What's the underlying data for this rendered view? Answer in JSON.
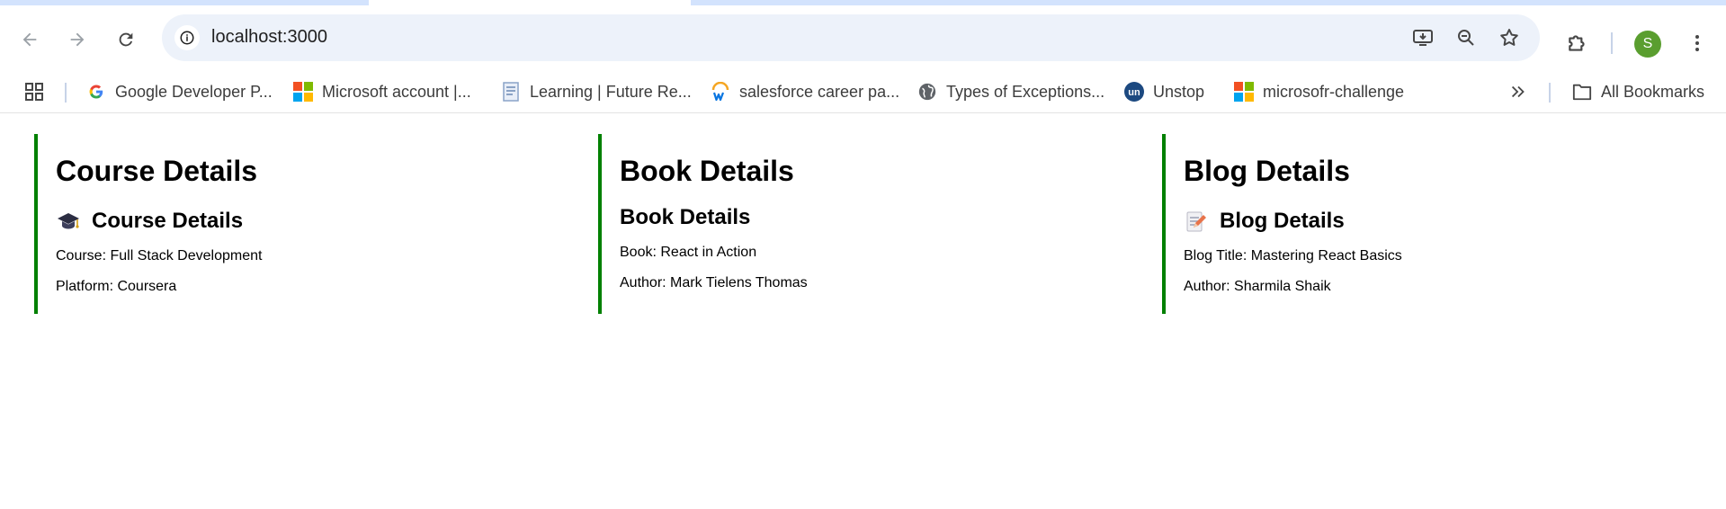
{
  "browser": {
    "url": "localhost:3000",
    "profile_initial": "S",
    "accent_color": "#008000"
  },
  "bookmarks": [
    {
      "label": "Google Developer P...",
      "icon": "google-icon"
    },
    {
      "label": "Microsoft account |...",
      "icon": "microsoft-icon"
    },
    {
      "label": "Learning | Future Re...",
      "icon": "document-icon"
    },
    {
      "label": "salesforce career pa...",
      "icon": "workday-icon"
    },
    {
      "label": "Types of Exceptions...",
      "icon": "globe-icon"
    },
    {
      "label": "Unstop",
      "icon": "unstop-icon"
    },
    {
      "label": "microsofr-challenge",
      "icon": "microsoft-icon"
    }
  ],
  "all_bookmarks_label": "All Bookmarks",
  "panels": {
    "course": {
      "heading": "Course Details",
      "subheading": "Course Details",
      "icon": "graduation-cap-icon",
      "lines": [
        "Course: Full Stack Development",
        "Platform: Coursera"
      ]
    },
    "book": {
      "heading": "Book Details",
      "subheading": "Book Details",
      "lines": [
        "Book: React in Action",
        "Author: Mark Tielens Thomas"
      ]
    },
    "blog": {
      "heading": "Blog Details",
      "subheading": "Blog Details",
      "icon": "memo-icon",
      "lines": [
        "Blog Title: Mastering React Basics",
        "Author: Sharmila Shaik"
      ]
    }
  }
}
